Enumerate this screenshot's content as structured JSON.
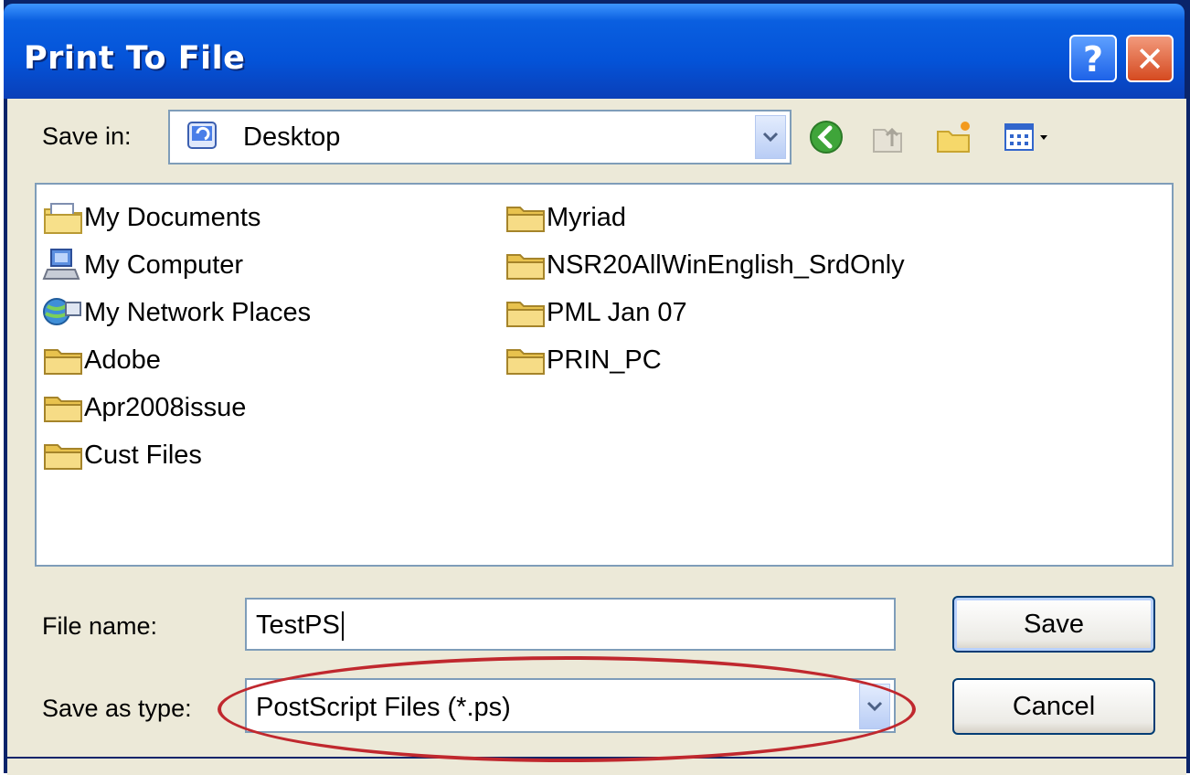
{
  "window": {
    "title": "Print To File",
    "help_label": "?",
    "close_label": "✕"
  },
  "save_in": {
    "label": "Save in:",
    "value": "Desktop"
  },
  "toolbar": [
    "back-icon",
    "up-folder-icon",
    "new-folder-icon",
    "view-menu-icon"
  ],
  "files": {
    "column1": [
      {
        "name": "My Documents",
        "icon": "my-documents-icon"
      },
      {
        "name": "My Computer",
        "icon": "my-computer-icon"
      },
      {
        "name": "My Network Places",
        "icon": "network-places-icon"
      },
      {
        "name": "Adobe",
        "icon": "folder-icon"
      },
      {
        "name": "Apr2008issue",
        "icon": "folder-icon"
      },
      {
        "name": "Cust Files",
        "icon": "folder-icon"
      }
    ],
    "column2": [
      {
        "name": "Myriad",
        "icon": "folder-icon"
      },
      {
        "name": "NSR20AllWinEnglish_SrdOnly",
        "icon": "folder-icon"
      },
      {
        "name": "PML Jan 07",
        "icon": "folder-icon"
      },
      {
        "name": "PRIN_PC",
        "icon": "folder-icon"
      }
    ]
  },
  "file_name": {
    "label": "File name:",
    "value": "TestPS"
  },
  "save_as_type": {
    "label": "Save as type:",
    "value": "PostScript Files (*.ps)"
  },
  "buttons": {
    "save": "Save",
    "cancel": "Cancel"
  },
  "colors": {
    "title_bar": "#0453d8",
    "highlight_ellipse": "#c0282e",
    "dialog_bg": "#ece9d8"
  }
}
